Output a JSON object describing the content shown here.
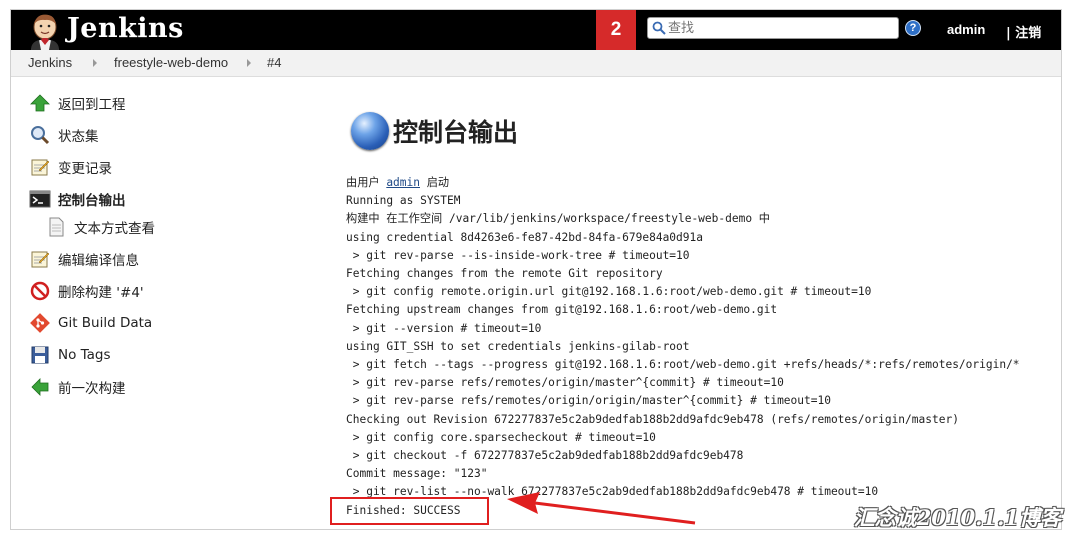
{
  "header": {
    "brand": "Jenkins",
    "badge": "2",
    "search_placeholder": "查找",
    "help_icon": "?",
    "user": "admin",
    "logout": "| 注销"
  },
  "breadcrumb": [
    "Jenkins",
    "freestyle-web-demo",
    "#4"
  ],
  "sidebar": {
    "items": [
      {
        "label": "返回到工程",
        "icon": "up-arrow-icon"
      },
      {
        "label": "状态集",
        "icon": "magnifier-icon"
      },
      {
        "label": "变更记录",
        "icon": "notepad-icon"
      },
      {
        "label": "控制台输出",
        "icon": "terminal-icon"
      },
      {
        "label": "文本方式查看",
        "icon": "document-icon"
      },
      {
        "label": "编辑编译信息",
        "icon": "notepad-icon"
      },
      {
        "label": "删除构建 '#4'",
        "icon": "no-entry-icon"
      },
      {
        "label": "Git Build Data",
        "icon": "git-icon"
      },
      {
        "label": "No Tags",
        "icon": "floppy-icon"
      },
      {
        "label": "前一次构建",
        "icon": "left-arrow-icon"
      }
    ]
  },
  "main": {
    "title": "控制台输出",
    "console_first": {
      "prefix": "由用户 ",
      "link": "admin",
      "suffix": " 启动"
    },
    "console_lines": [
      "Running as SYSTEM",
      "构建中 在工作空间 /var/lib/jenkins/workspace/freestyle-web-demo 中",
      "using credential 8d4263e6-fe87-42bd-84fa-679e84a0d91a",
      " > git rev-parse --is-inside-work-tree # timeout=10",
      "Fetching changes from the remote Git repository",
      " > git config remote.origin.url git@192.168.1.6:root/web-demo.git # timeout=10",
      "Fetching upstream changes from git@192.168.1.6:root/web-demo.git",
      " > git --version # timeout=10",
      "using GIT_SSH to set credentials jenkins-gilab-root",
      " > git fetch --tags --progress git@192.168.1.6:root/web-demo.git +refs/heads/*:refs/remotes/origin/*",
      " > git rev-parse refs/remotes/origin/master^{commit} # timeout=10",
      " > git rev-parse refs/remotes/origin/origin/master^{commit} # timeout=10",
      "Checking out Revision 672277837e5c2ab9dedfab188b2dd9afdc9eb478 (refs/remotes/origin/master)",
      " > git config core.sparsecheckout # timeout=10",
      " > git checkout -f 672277837e5c2ab9dedfab188b2dd9afdc9eb478",
      "Commit message: \"123\"",
      " > git rev-list --no-walk 672277837e5c2ab9dedfab188b2dd9afdc9eb478 # timeout=10",
      "Finished: SUCCESS"
    ]
  },
  "colors": {
    "accent_red": "#e01f1f",
    "header_bg": "#000000",
    "badge_bg": "#d62a2a"
  },
  "watermark": "汇念诚2010.1.1博客"
}
